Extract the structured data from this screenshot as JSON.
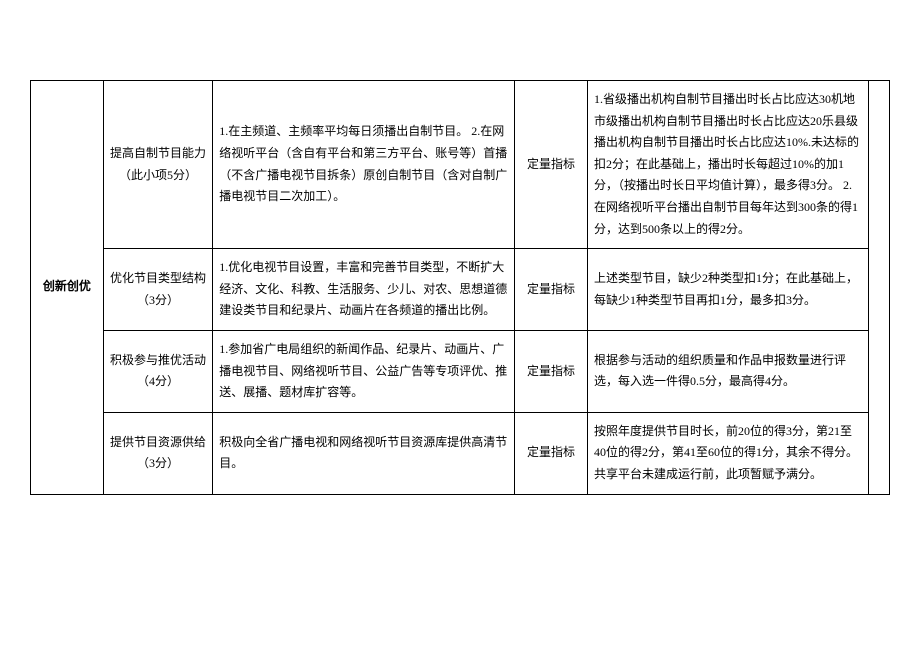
{
  "table": {
    "category": "创新创优",
    "rows": [
      {
        "item": "提高自制节目能力（此小项5分）",
        "desc": "1.在主频道、主频率平均每日须播出自制节目。\n2.在网络视听平台（含自有平台和第三方平台、账号等）首播（不含广播电视节目拆条）原创自制节目（含对自制广播电视节目二次加工）。",
        "type": "定量指标",
        "criteria": "1.省级播出机构自制节目播出时长占比应达30机地市级播出机构自制节目播出时长占比应达20乐县级播出机构自制节目播出时长占比应达10%.未达标的扣2分；在此基础上，播出时长每超过10%的加1分，（按播出时长日平均值计算），最多得3分。\n2.在网络视听平台播出自制节目每年达到300条的得1分，达到500条以上的得2分。"
      },
      {
        "item": "优化节目类型结构（3分）",
        "desc": "1.优化电视节目设置，丰富和完善节目类型，不断扩大经济、文化、科教、生活服务、少儿、对农、思想道德建设类节目和纪录片、动画片在各频道的播出比例。",
        "type": "定量指标",
        "criteria": "上述类型节目，缺少2种类型扣1分；在此基础上，每缺少1种类型节目再扣1分，最多扣3分。"
      },
      {
        "item": "积极参与推优活动（4分）",
        "desc": "1.参加省广电局组织的新闻作品、纪录片、动画片、广播电视节目、网络视听节目、公益广告等专项评优、推送、展播、题材库扩容等。",
        "type": "定量指标",
        "criteria": "根据参与活动的组织质量和作品申报数量进行评选，每入选一件得0.5分，最高得4分。"
      },
      {
        "item": "提供节目资源供给（3分）",
        "desc": "积极向全省广播电视和网络视听节目资源库提供高清节目。",
        "type": "定量指标",
        "criteria": "按照年度提供节目时长，前20位的得3分，第21至40位的得2分，第41至60位的得1分，其余不得分。共享平台未建成运行前，此项暂赋予满分。"
      }
    ]
  }
}
